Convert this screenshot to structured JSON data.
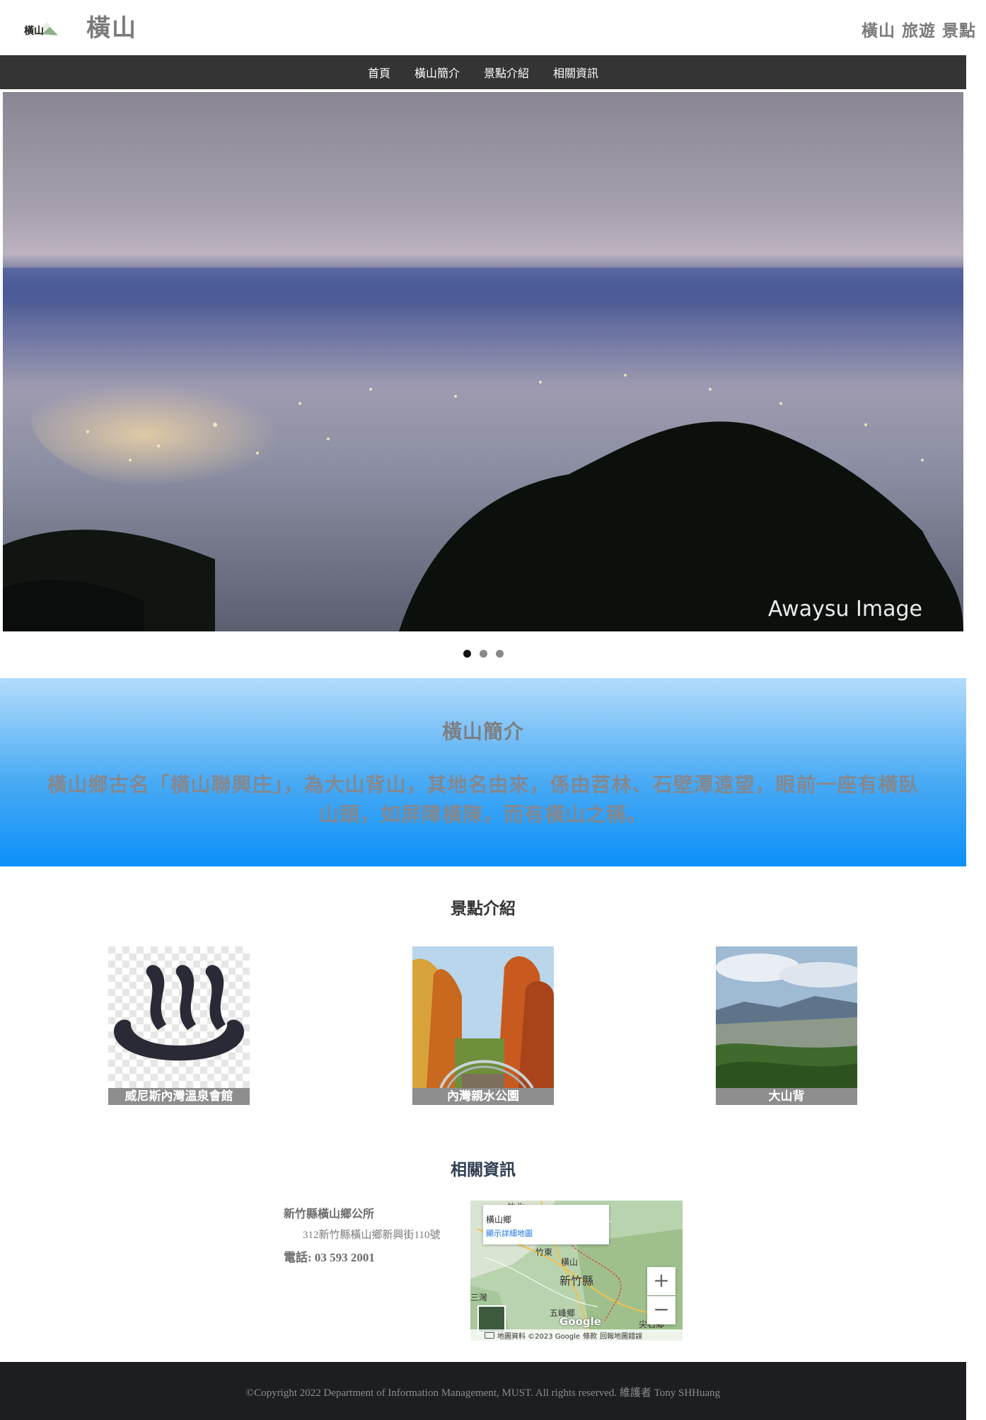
{
  "header": {
    "logo_text": "橫山",
    "site_title": "橫山",
    "tagline": "橫山 旅遊 景點"
  },
  "nav": {
    "items": [
      "首頁",
      "橫山簡介",
      "景點介紹",
      "相關資訊"
    ]
  },
  "hero": {
    "image_credit": "Awaysu Image",
    "slide_count": 3,
    "active_slide": 1
  },
  "intro": {
    "title": "橫山簡介",
    "body": "橫山鄉古名「橫山聯興庄」，為大山背山，其地名由來，係由苕林、石壁潭遠望，眼前一座有橫臥山頭，如屏障橫陳，而有橫山之稱。"
  },
  "attractions": {
    "title": "景點介紹",
    "items": [
      {
        "label": "威尼斯內灣溫泉會館",
        "icon": "hot-spring-icon"
      },
      {
        "label": "內灣親水公園",
        "icon": "park-photo"
      },
      {
        "label": "大山背",
        "icon": "mountain-photo"
      }
    ]
  },
  "info": {
    "title": "相關資訊",
    "office_name": "新竹縣橫山鄉公所",
    "address": "312新竹縣橫山鄉新興街110號",
    "phone": "電話: 03 593 2001"
  },
  "map": {
    "place_title": "橫山鄉",
    "detail_link": "顯示詳細地圖",
    "zoom_in": "+",
    "zoom_out": "−",
    "google": "Google",
    "footer_data": "地圖資料 ©2023 Google",
    "footer_terms": "條款",
    "footer_report": "回報地圖錯誤",
    "labels": [
      "竹北",
      "竹東",
      "橫山",
      "新竹縣",
      "五峰鄉",
      "尖石鄉",
      "三灣"
    ]
  },
  "footer": {
    "copyright": "©Copyright 2022 Department of Information Management, MUST. All rights reserved. 維護者 Tony SHHuang"
  },
  "colors": {
    "navbar": "#343434",
    "footer": "#1d1e22",
    "intro_top": "#b3dcfb",
    "intro_bottom": "#0c90f9",
    "card_label": "#8e8e8e"
  }
}
